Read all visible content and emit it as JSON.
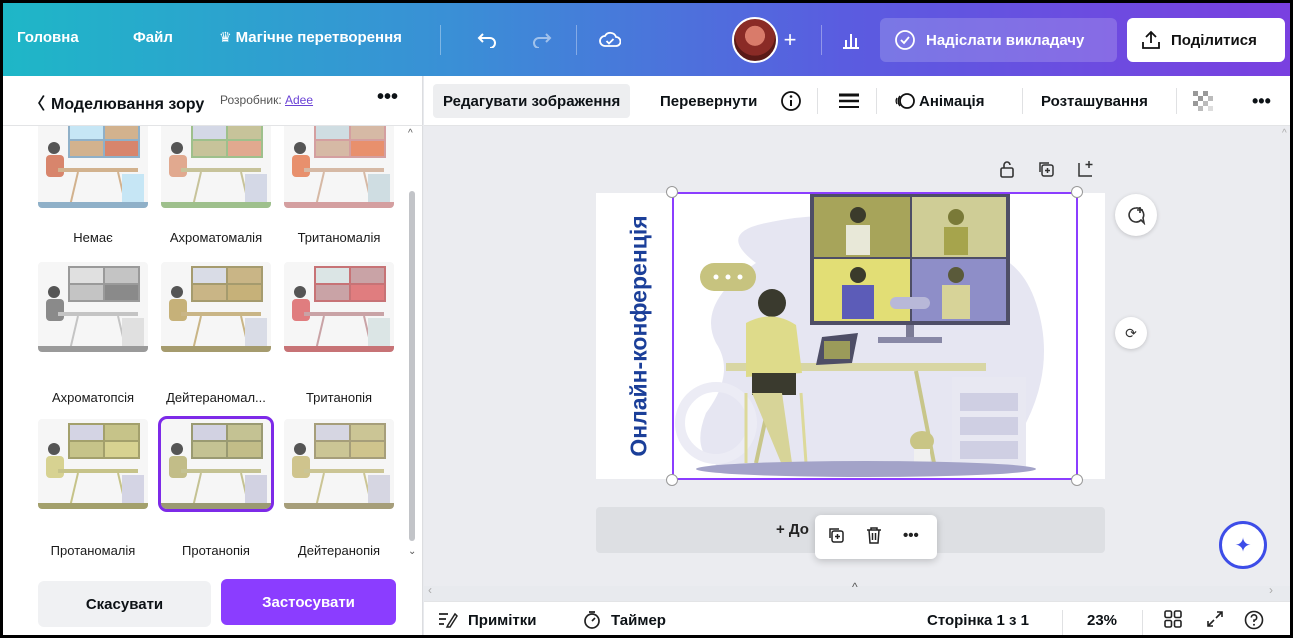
{
  "topbar": {
    "home": "Головна",
    "file": "Файл",
    "magic_icon": "crown-icon",
    "magic": "Магічне перетворення",
    "send_teacher": "Надіслати викладачу",
    "share": "Поділитися"
  },
  "left_panel": {
    "title": "Моделювання зору",
    "developer_prefix": "Розробник:",
    "developer_name": "Adee",
    "thumbnails": [
      {
        "label": "Немає"
      },
      {
        "label": "Ахроматомалія"
      },
      {
        "label": "Тританомалія"
      },
      {
        "label": "Ахроматопсія"
      },
      {
        "label": "Дейтераномал..."
      },
      {
        "label": "Тританопія"
      },
      {
        "label": "Протаномалія"
      },
      {
        "label": "Протанопія",
        "selected": true
      },
      {
        "label": "Дейтеранопія"
      }
    ],
    "cancel": "Скасувати",
    "apply": "Застосувати"
  },
  "toolbar": {
    "edit_image": "Редагувати зображення",
    "flip": "Перевернути",
    "animation": "Анімація",
    "position": "Розташування"
  },
  "canvas": {
    "slide_title": "Онлайн-конференція",
    "add_page": "+ До"
  },
  "bottombar": {
    "notes": "Примітки",
    "timer": "Таймер",
    "page": "Сторінка 1 з 1",
    "zoom": "23%"
  },
  "colors": {
    "accent": "#8b3dff",
    "title_blue": "#1b3f99"
  }
}
